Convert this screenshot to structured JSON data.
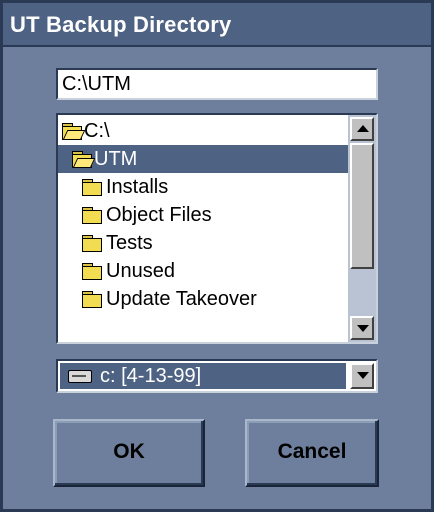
{
  "window": {
    "title": "UT Backup Directory"
  },
  "path_field": {
    "value": "C:\\UTM"
  },
  "directory_list": {
    "items": [
      {
        "label": "C:\\",
        "icon": "open-folder-icon",
        "selected": false
      },
      {
        "label": "UTM",
        "icon": "open-folder-icon",
        "selected": true
      },
      {
        "label": "Installs",
        "icon": "folder-icon",
        "selected": false
      },
      {
        "label": "Object Files",
        "icon": "folder-icon",
        "selected": false
      },
      {
        "label": "Tests",
        "icon": "folder-icon",
        "selected": false
      },
      {
        "label": "Unused",
        "icon": "folder-icon",
        "selected": false
      },
      {
        "label": "Update Takeover",
        "icon": "folder-icon",
        "selected": false
      }
    ]
  },
  "drive_select": {
    "value": "c: [4-13-99]",
    "icon": "hard-drive-icon"
  },
  "buttons": {
    "ok_label": "OK",
    "cancel_label": "Cancel"
  },
  "colors": {
    "dialog_bg": "#6d7f9c",
    "titlebar": "#4e6283",
    "selection": "#4e6283",
    "border_dark": "#2a3a55"
  }
}
